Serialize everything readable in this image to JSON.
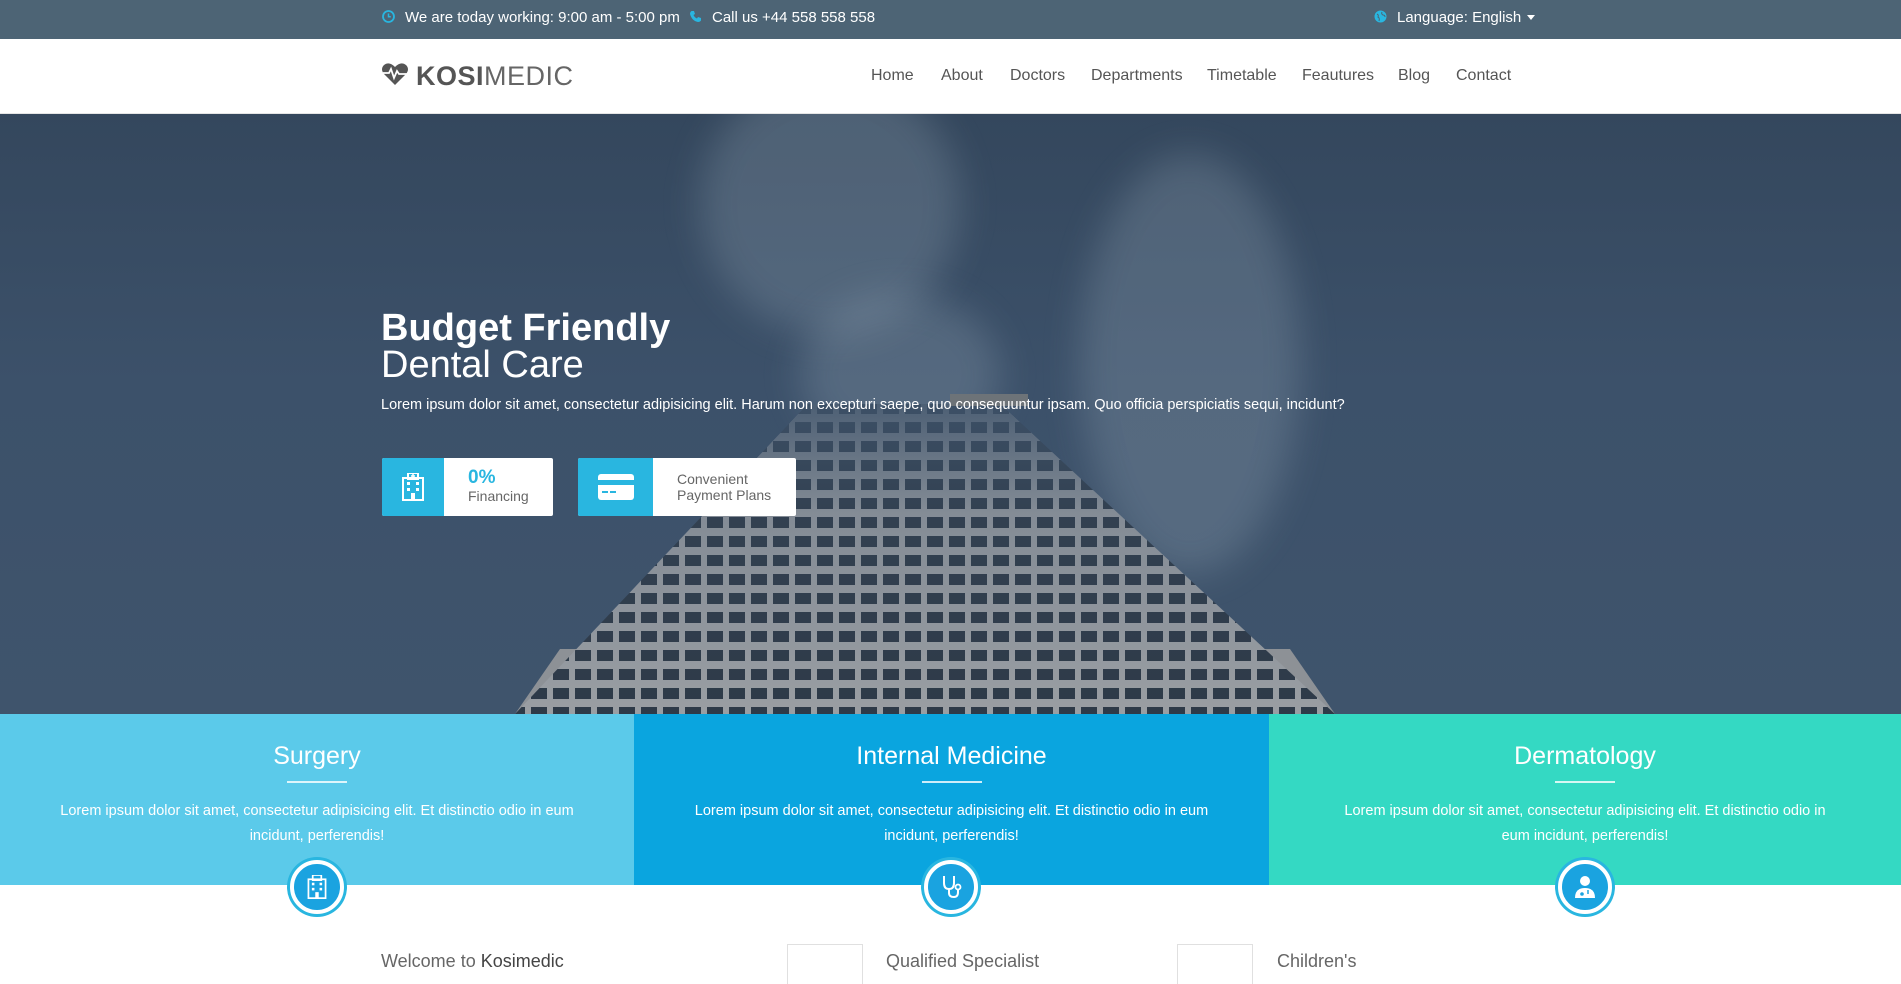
{
  "topbar": {
    "hours_text": "We are today working: 9:00 am - 5:00 pm",
    "phone_text": "Call us +44 558 558 558",
    "language_text": "Language: English",
    "icons": [
      "clock-icon",
      "phone-icon",
      "globe-icon"
    ]
  },
  "header": {
    "logo_bold": "KOSI",
    "logo_light": "MEDIC",
    "nav": [
      "Home",
      "About",
      "Doctors",
      "Departments",
      "Timetable",
      "Feautures",
      "Blog",
      "Contact"
    ]
  },
  "hero": {
    "title_line1": "Budget Friendly",
    "title_line2": "Dental Care",
    "description": "Lorem ipsum dolor sit amet, consectetur adipisicing elit. Harum non excepturi saepe, quo consequuntur ipsam. Quo officia perspiciatis sequi, incidunt?",
    "badges": [
      {
        "icon": "hospital-icon",
        "big": "0%",
        "small": "Financing"
      },
      {
        "icon": "credit-card-icon",
        "line1": "Convenient",
        "line2": "Payment Plans"
      }
    ]
  },
  "departments": [
    {
      "title": "Surgery",
      "text": "Lorem ipsum dolor sit amet, consectetur adipisicing elit. Et distinctio odio in eum incidunt, perferendis!",
      "icon": "hospital-icon",
      "color": "#5bcaea"
    },
    {
      "title": "Internal Medicine",
      "text": "Lorem ipsum dolor sit amet, consectetur adipisicing elit. Et distinctio odio in eum incidunt, perferendis!",
      "icon": "stethoscope-icon",
      "color": "#0aa5df"
    },
    {
      "title": "Dermatology",
      "text": "Lorem ipsum dolor sit amet, consectetur adipisicing elit. Et distinctio odio in eum incidunt, perferendis!",
      "icon": "doctor-icon",
      "color": "#34d9c3"
    }
  ],
  "bottom": {
    "welcome_prefix": "Welcome to",
    "welcome_name": "Kosimedic",
    "qualified": "Qualified Specialist",
    "childrens": "Children's"
  },
  "colors": {
    "accent": "#29b6e0",
    "topbar": "#4d6475"
  }
}
